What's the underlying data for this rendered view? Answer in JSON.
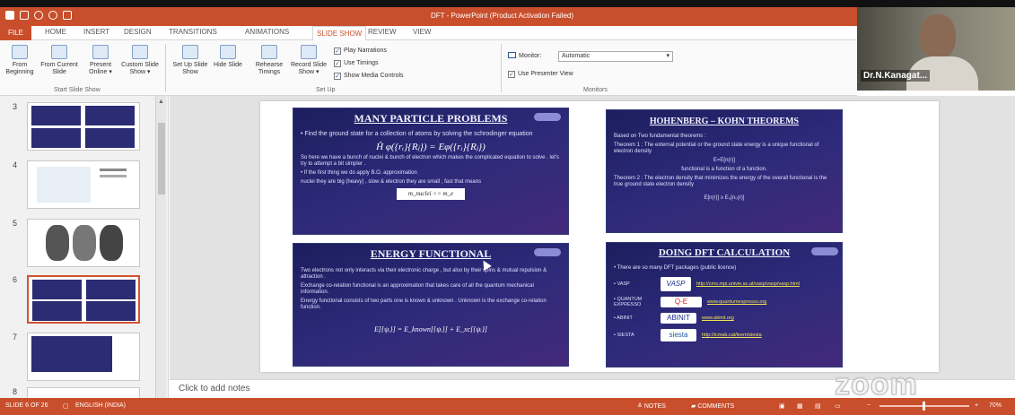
{
  "app": {
    "window_title": "DFT - PowerPoint (Product Activation Failed)"
  },
  "colors": {
    "accent": "#c94e2b",
    "slide_panel": "#2d2a7a"
  },
  "tabs": [
    {
      "label": "FILE"
    },
    {
      "label": "HOME"
    },
    {
      "label": "INSERT"
    },
    {
      "label": "DESIGN"
    },
    {
      "label": "TRANSITIONS"
    },
    {
      "label": "ANIMATIONS"
    },
    {
      "label": "SLIDE SHOW"
    },
    {
      "label": "REVIEW"
    },
    {
      "label": "VIEW"
    }
  ],
  "ribbon": {
    "start": {
      "from_beginning": "From Beginning",
      "from_current": "From Current Slide",
      "present_online": "Present Online ▾",
      "custom": "Custom Slide Show ▾",
      "group": "Start Slide Show"
    },
    "setup": {
      "setup_show": "Set Up Slide Show",
      "hide": "Hide Slide",
      "rehearse": "Rehearse Timings",
      "record": "Record Slide Show ▾",
      "play_narrations": "Play Narrations",
      "use_timings": "Use Timings",
      "show_media": "Show Media Controls",
      "group": "Set Up"
    },
    "monitors": {
      "monitor_label": "Monitor:",
      "monitor_value": "Automatic",
      "presenter_view": "Use Presenter View",
      "group": "Monitors"
    }
  },
  "video": {
    "participant": "Dr.N.Kanagat..."
  },
  "thumbnails": [
    {
      "num": "3"
    },
    {
      "num": "4"
    },
    {
      "num": "5"
    },
    {
      "num": "6"
    },
    {
      "num": "7"
    },
    {
      "num": "8"
    }
  ],
  "slide": {
    "p1": {
      "title": "MANY PARTICLE PROBLEMS",
      "text1": "• Find the ground state for a collection of atoms by solving the schrodinger equation",
      "formula": "Ĥ φ({rᵢ}{Rⱼ}) = Eφ({rᵢ}{Rⱼ})",
      "text2": "So here we have a bunch of nuclei & bunch of electron which makes the complicated equation to solve . let's try to attempt a bit simpler .",
      "text3": "• If the first thing we do apply B.O. approximation",
      "text4": "nuclei they are big (heavy) , slow & electron they are small , fast that means",
      "box": "m_nuclei >> m_e"
    },
    "p2": {
      "title": "HOHENBERG – KOHN THEOREMS",
      "text1": "Based on Two fundamental theorems :",
      "text2": "Theorem 1 : The external potential or the ground state energy is a unique functional of electron density",
      "text3": "E=E[n(r)]",
      "text4": "functional is a function of a function.",
      "text5": "Theorem 2 : The electron density that minimizes the energy of the overall functional is the true ground state electron density",
      "text6": "E[n(r)] ≥ E₀[n₀(r)]"
    },
    "p3": {
      "title": "ENERGY FUNCTIONAL",
      "text1": "Two electrons not only interacts via their electronic charge , but also by their spins & mutual repulsion & attraction .",
      "text2": "Exchange co-relation functional is an approximation that takes care of all the quantum mechanical information.",
      "text3": "Energy functional consists of two parts one is known & unknown . Unknown is the exchange co-relation function.",
      "formula": "E[{ψᵢ}] = E_known[{ψᵢ}] + E_xc[{ψᵢ}]"
    },
    "p4": {
      "title": "DOING DFT CALCULATION",
      "intro": "• There are so many DFT packages (public licence)",
      "rows": [
        {
          "name": "• VASP",
          "logo": "VASP",
          "link": "http://cms.mpi.univie.ac.at/vasp/vasp/vasp.html"
        },
        {
          "name": "• QUANTUM EXPRESSO",
          "logo": "Q-E",
          "link": "www.quantumespresso.org"
        },
        {
          "name": "• ABINIT",
          "logo": "ABINIT",
          "link": "www.abinit.org"
        },
        {
          "name": "• SIESTA",
          "logo": "siesta",
          "link": "http://icmab.cat/leem/siesta"
        }
      ]
    }
  },
  "notes": {
    "placeholder": "Click to add notes"
  },
  "status": {
    "slide": "SLIDE 6 OF 26",
    "language": "ENGLISH (INDIA)",
    "notes": "NOTES",
    "comments": "COMMENTS",
    "zoom": "70%"
  },
  "overlay": {
    "zoom_brand": "zoom"
  }
}
